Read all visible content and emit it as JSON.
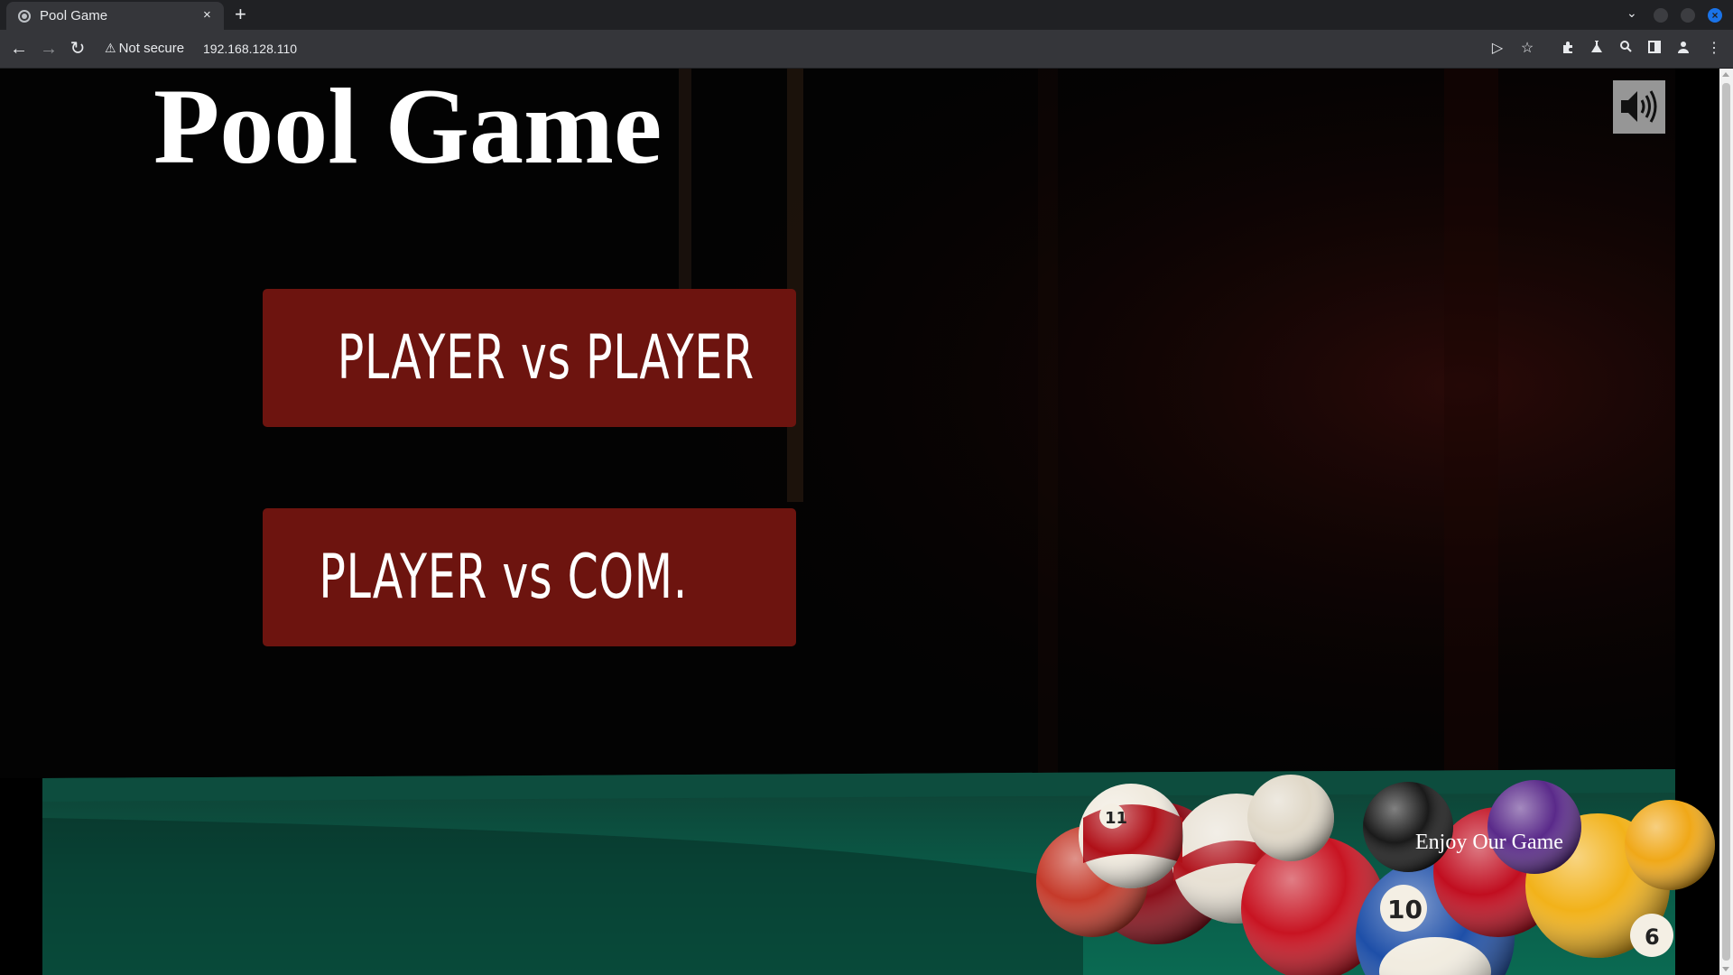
{
  "browser": {
    "tab_title": "Pool Game",
    "tab_close": "×",
    "new_tab": "+",
    "security_label": "Not secure",
    "url": "192.168.128.110"
  },
  "page": {
    "title": "Pool Game",
    "buttons": {
      "pvp_label": "PLAYER vs PLAYER",
      "pvc_label": "PLAYER vs COM."
    },
    "footer_text": "Enjoy Our Game"
  },
  "colors": {
    "button_bg": "#6d140f",
    "felt": "#0b4a3a",
    "sound_button_bg": "#969696"
  },
  "icons": {
    "sound": "speaker-volume-icon",
    "back": "arrow-left-icon",
    "forward": "arrow-right-icon",
    "reload": "reload-icon"
  }
}
